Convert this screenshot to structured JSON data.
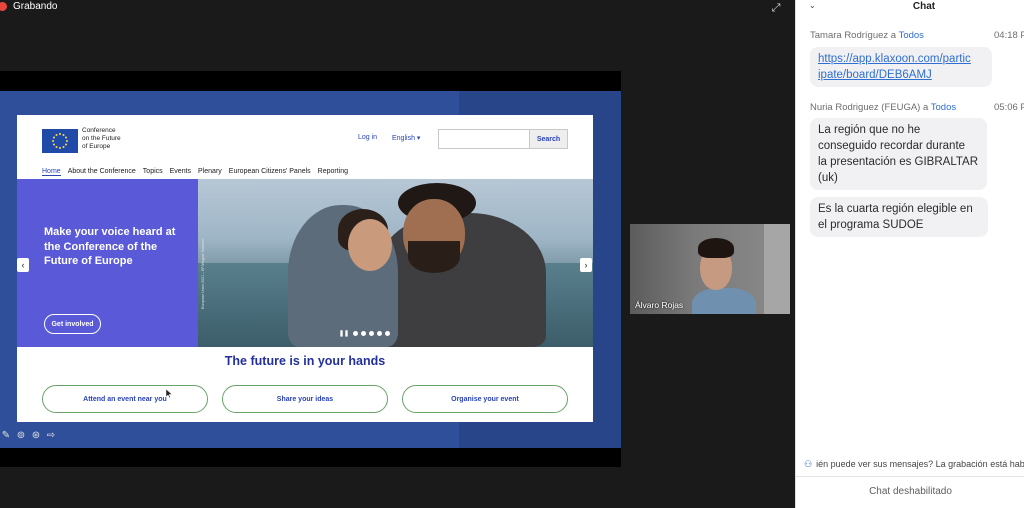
{
  "meeting": {
    "recording_label": "Grabando",
    "expand_icon": "expand-icon"
  },
  "site": {
    "logo_lines": [
      "Conference",
      "on the Future",
      "of Europe"
    ],
    "login": "Log in",
    "language": "English ▾",
    "search_placeholder": "",
    "search_button": "Search",
    "nav": [
      "Home",
      "About the Conference",
      "Topics",
      "Events",
      "Plenary",
      "European Citizens' Panels",
      "Reporting"
    ],
    "hero_title": "Make your voice heard at the Conference of the Future of Europe",
    "hero_button": "Get involved",
    "hero_credit": "European Union 2021 – EP/Wagner Salzaker",
    "tagline": "The future is in your hands",
    "cta": [
      "Attend an event near you",
      "Share your ideas",
      "Organise your event"
    ]
  },
  "video": {
    "participant_name": "Álvaro Rojas"
  },
  "chat": {
    "title": "Chat",
    "messages": [
      {
        "sender": "Tamara Rodríguez",
        "to_prefix": "a",
        "to": "Todos",
        "time": "04:18 P",
        "lines": [
          "https://app.klaxoon.com/partic",
          "ipate/board/DEB6AMJ"
        ]
      },
      {
        "sender": "Nuria Rodriguez (FEUGA)",
        "to_prefix": "a",
        "to": "Todos",
        "time": "05:06 P",
        "lines": [
          "La región que no he",
          "conseguido recordar durante",
          "la presentación es GIBRALTAR",
          "(uk)"
        ]
      },
      {
        "lines": [
          "Es la cuarta región elegible en",
          "el programa SUDOE"
        ]
      }
    ],
    "notice": "ién puede ver sus mensajes? La grabación está hab",
    "disabled": "Chat deshabilitado"
  }
}
